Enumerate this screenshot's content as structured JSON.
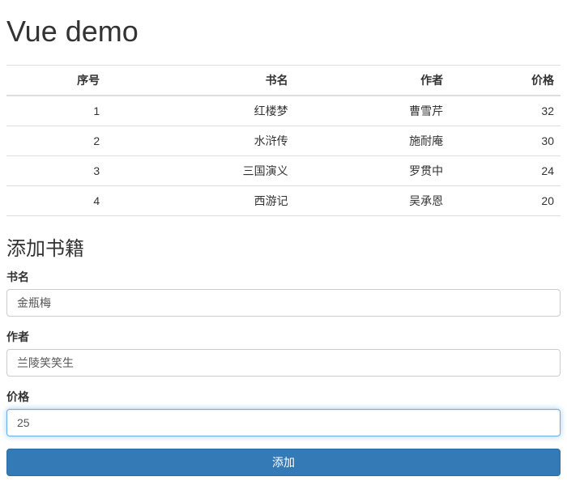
{
  "page_title": "Vue demo",
  "table": {
    "headers": [
      "序号",
      "书名",
      "作者",
      "价格"
    ],
    "rows": [
      {
        "index": "1",
        "name": "红楼梦",
        "author": "曹雪芹",
        "price": "32"
      },
      {
        "index": "2",
        "name": "水浒传",
        "author": "施耐庵",
        "price": "30"
      },
      {
        "index": "3",
        "name": "三国演义",
        "author": "罗贯中",
        "price": "24"
      },
      {
        "index": "4",
        "name": "西游记",
        "author": "吴承恩",
        "price": "20"
      }
    ]
  },
  "form": {
    "heading": "添加书籍",
    "name_label": "书名",
    "name_value": "金瓶梅",
    "author_label": "作者",
    "author_value": "兰陵笑笑生",
    "price_label": "价格",
    "price_value": "25",
    "submit_label": "添加"
  }
}
